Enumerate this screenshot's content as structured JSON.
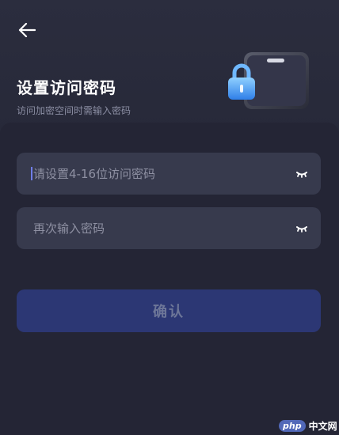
{
  "header": {
    "title": "设置访问密码",
    "subtitle": "访问加密空间时需输入密码",
    "back_icon": "arrow-left-icon",
    "illustration_icon": "padlock-phone-icon"
  },
  "form": {
    "password_placeholder": "请设置4-16位访问密码",
    "confirm_placeholder": "再次输入密码",
    "visibility_icon": "eye-closed-icon"
  },
  "actions": {
    "confirm_label": "确认"
  },
  "watermark": {
    "logo": "php",
    "text": "中文网"
  },
  "colors": {
    "background": "#1f2030",
    "header": "#2b2d3e",
    "field": "#373a4d",
    "button": "#2c3774",
    "accent": "#6f7eea",
    "lock": "#4fa3ff"
  }
}
